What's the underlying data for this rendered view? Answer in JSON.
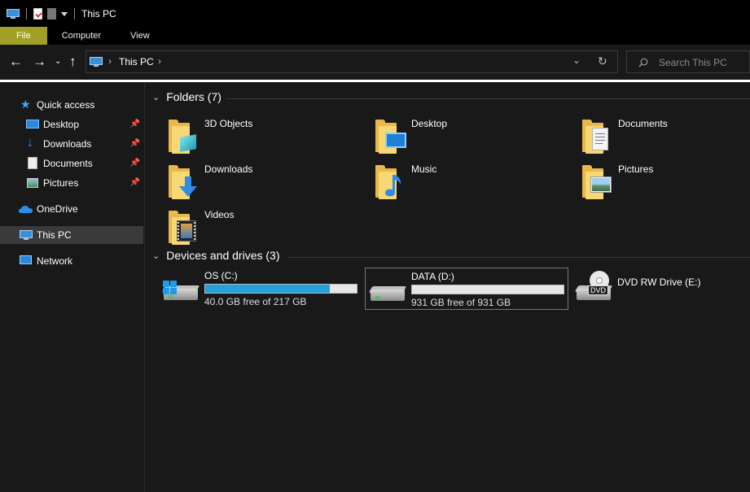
{
  "window": {
    "title": "This PC"
  },
  "ribbon": {
    "tabs": [
      "File",
      "Computer",
      "View"
    ]
  },
  "address": {
    "path": [
      "This PC"
    ]
  },
  "search": {
    "placeholder": "Search This PC"
  },
  "sidebar": {
    "items": [
      {
        "label": "Quick access",
        "icon": "star-icon"
      },
      {
        "label": "Desktop",
        "icon": "desktop-icon",
        "pinned": true
      },
      {
        "label": "Downloads",
        "icon": "download-icon",
        "pinned": true
      },
      {
        "label": "Documents",
        "icon": "documents-icon",
        "pinned": true
      },
      {
        "label": "Pictures",
        "icon": "pictures-icon",
        "pinned": true
      },
      {
        "label": "OneDrive",
        "icon": "cloud-icon"
      },
      {
        "label": "This PC",
        "icon": "computer-icon",
        "selected": true
      },
      {
        "label": "Network",
        "icon": "network-icon"
      }
    ]
  },
  "folders": {
    "header": "Folders (7)",
    "items": [
      {
        "label": "3D Objects",
        "icon": "3d-objects-folder-icon"
      },
      {
        "label": "Desktop",
        "icon": "desktop-folder-icon"
      },
      {
        "label": "Documents",
        "icon": "documents-folder-icon"
      },
      {
        "label": "Downloads",
        "icon": "downloads-folder-icon"
      },
      {
        "label": "Music",
        "icon": "music-folder-icon"
      },
      {
        "label": "Pictures",
        "icon": "pictures-folder-icon"
      },
      {
        "label": "Videos",
        "icon": "videos-folder-icon"
      }
    ]
  },
  "drives": {
    "header": "Devices and drives (3)",
    "items": [
      {
        "name": "OS (C:)",
        "free_text": "40.0 GB free of 217 GB",
        "used_fraction": 0.82,
        "icon": "windows-drive-icon"
      },
      {
        "name": "DATA (D:)",
        "free_text": "931 GB free of 931 GB",
        "used_fraction": 0.0,
        "icon": "hard-drive-icon",
        "selected": true
      },
      {
        "name": "DVD RW Drive (E:)",
        "icon": "dvd-drive-icon",
        "badge": "DVD"
      }
    ]
  },
  "colors": {
    "accent": "#26a0da",
    "file_tab": "#a0a026",
    "background": "#191919"
  }
}
